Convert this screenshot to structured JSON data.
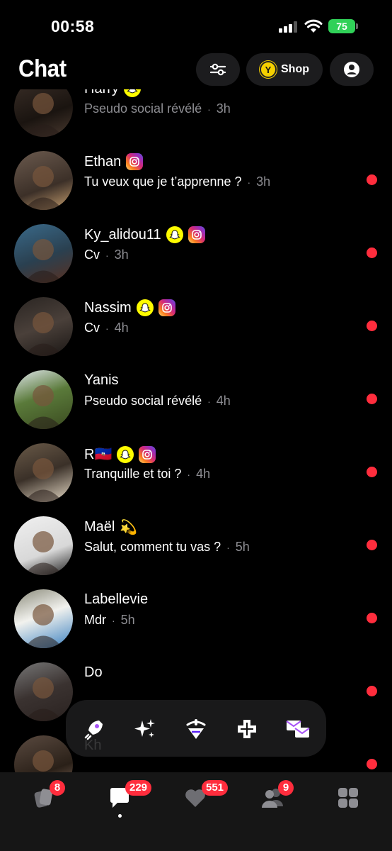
{
  "status_bar": {
    "time": "00:58",
    "battery": "75"
  },
  "header": {
    "title": "Chat",
    "shop_label": "Shop",
    "shop_coin_letter": "Y"
  },
  "chats": [
    {
      "name": "Harry",
      "badges": [
        "snapchat"
      ],
      "preview": "Pseudo social révélé",
      "time": "3h",
      "unread": false
    },
    {
      "name": "Ethan",
      "badges": [
        "instagram"
      ],
      "preview": "Tu veux que je t’apprenne ?",
      "time": "3h",
      "unread": true
    },
    {
      "name": "Ky_alidou11",
      "badges": [
        "snapchat",
        "instagram"
      ],
      "preview": "Cv",
      "time": "3h",
      "unread": true
    },
    {
      "name": "Nassim",
      "badges": [
        "snapchat",
        "instagram"
      ],
      "preview": "Cv",
      "time": "4h",
      "unread": true
    },
    {
      "name": "Yanis",
      "badges": [],
      "preview": "Pseudo social révélé",
      "time": "4h",
      "unread": true
    },
    {
      "name": "R🇭🇹",
      "badges": [
        "snapchat",
        "instagram"
      ],
      "preview": "Tranquille et toi ?",
      "time": "4h",
      "unread": true
    },
    {
      "name": "Maël",
      "badges": [
        "dizzy"
      ],
      "preview": "Salut, comment tu vas ?",
      "time": "5h",
      "unread": true
    },
    {
      "name": "Labellevie",
      "badges": [],
      "preview": "Mdr",
      "time": "5h",
      "unread": true
    },
    {
      "name": "Do",
      "badges": [],
      "preview": "",
      "time": "",
      "unread": true
    },
    {
      "name": "Kh",
      "badges": [],
      "preview": "",
      "time": "",
      "unread": true
    }
  ],
  "dock": [
    {
      "icon": "rocket-icon",
      "color": "#a855f7"
    },
    {
      "icon": "sparkles-icon",
      "color": "#22c55e"
    },
    {
      "icon": "spinning-top-icon",
      "color": "#5b21f5"
    },
    {
      "icon": "puzzle-icon",
      "color": "#111111"
    },
    {
      "icon": "envelopes-icon",
      "color": "#a855f7"
    }
  ],
  "tabs": [
    {
      "icon": "cards-icon",
      "badge": "8"
    },
    {
      "icon": "chat-bubble-icon",
      "badge": "229"
    },
    {
      "icon": "heart-icon",
      "badge": "551"
    },
    {
      "icon": "friends-icon",
      "badge": "9"
    },
    {
      "icon": "grid-icon",
      "badge": ""
    }
  ],
  "colors": {
    "unread": "#ff2d3d",
    "snapchat": "#fffc00",
    "battery": "#30d158"
  }
}
